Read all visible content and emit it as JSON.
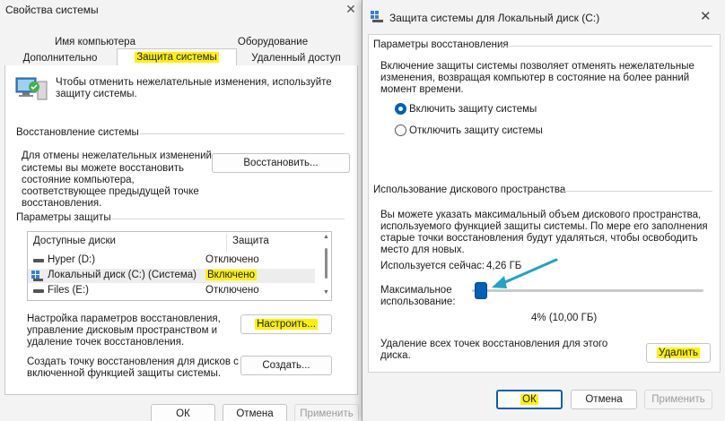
{
  "back_window": {
    "title": "Свойства системы",
    "close_glyph": "✕",
    "tabs_row1": [
      "Имя компьютера",
      "Оборудование"
    ],
    "tabs_row2": [
      "Дополнительно",
      "Защита системы",
      "Удаленный доступ"
    ],
    "intro_text_1": "Чтобы отменить нежелательные изменения, используйте",
    "intro_text_2": "защиту системы.",
    "restore_group": "Восстановление системы",
    "restore_desc": [
      "Для отмены нежелательных изменений",
      "системы вы можете восстановить",
      "состояние компьютера,",
      "соответствующее предыдущей точке",
      "восстановления."
    ],
    "restore_button": "Восстановить...",
    "protection_group": "Параметры защиты",
    "list_headers": [
      "Доступные диски",
      "Защита"
    ],
    "drives": [
      {
        "name": "Hyper (D:)",
        "status": "Отключено"
      },
      {
        "name": "Локальный диск (C:) (Система)",
        "status": "Включено"
      },
      {
        "name": "Files (E:)",
        "status": "Отключено"
      }
    ],
    "configure_desc": [
      "Настройка параметров восстановления,",
      "управление дисковым пространством и",
      "удаление точек восстановления."
    ],
    "configure_button": "Настроить...",
    "create_desc": [
      "Создать точку восстановления для дисков с",
      "включенной функцией защиты системы."
    ],
    "create_button": "Создать...",
    "ok": "ОК",
    "cancel": "Отмена",
    "apply": "Применить"
  },
  "dialog": {
    "title": "Защита системы для Локальный диск (C:)",
    "close_glyph": "✕",
    "restore_settings_group": "Параметры восстановления",
    "restore_settings_desc": [
      "Включение защиты системы позволяет отменять нежелательные",
      "изменения, возвращая компьютер в состояние на более ранний",
      "момент времени."
    ],
    "radio_on": "Включить защиту системы",
    "radio_off": "Отключить защиту системы",
    "disk_usage_group": "Использование дискового пространства",
    "disk_usage_desc": [
      "Вы можете указать максимальный объем дискового пространства,",
      "используемого функцией защиты системы. По мере его заполнения",
      "старые точки восстановления будут удаляться, чтобы освободить",
      "место для новых."
    ],
    "current_usage_label": "Используется сейчас:",
    "current_usage_value": "4,26 ГБ",
    "max_usage_label_1": "Максимальное",
    "max_usage_label_2": "использование:",
    "max_usage_value": "4% (10,00 ГБ)",
    "max_usage_fraction": 0.04,
    "delete_desc": [
      "Удаление всех точек восстановления для этого",
      "диска."
    ],
    "delete_button": "Удалить",
    "ok": "ОК",
    "cancel": "Отмена",
    "apply": "Применить"
  },
  "colors": {
    "accent": "#005fb8",
    "highlight": "#fff200",
    "annotation_arrow": "#1fa3c8"
  }
}
